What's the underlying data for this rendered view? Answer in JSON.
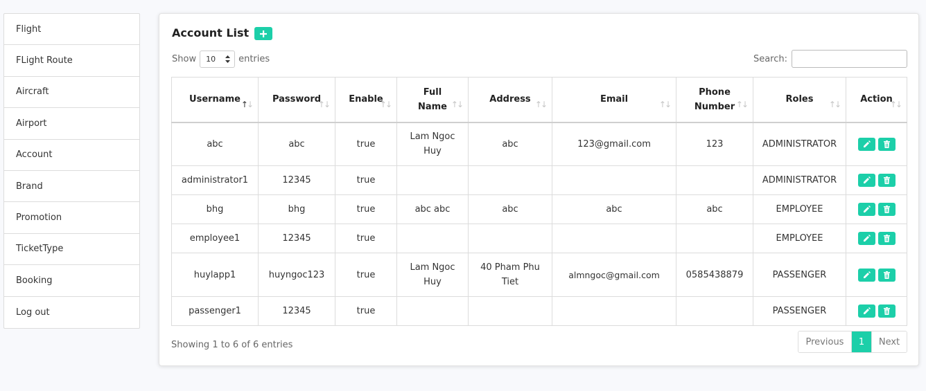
{
  "sidebar": {
    "items": [
      {
        "label": "Flight"
      },
      {
        "label": "FLight Route"
      },
      {
        "label": "Aircraft"
      },
      {
        "label": "Airport"
      },
      {
        "label": "Account"
      },
      {
        "label": "Brand"
      },
      {
        "label": "Promotion"
      },
      {
        "label": "TicketType"
      },
      {
        "label": "Booking"
      },
      {
        "label": "Log out"
      }
    ]
  },
  "main": {
    "title": "Account List",
    "add_icon": "plus-icon",
    "show_label": "Show",
    "entries_value": "10",
    "entries_label": "entries",
    "search_label": "Search:",
    "search_value": "",
    "accent_color": "#1ccfa9"
  },
  "table": {
    "columns": [
      {
        "label": "Username",
        "sorted": "asc"
      },
      {
        "label": "Password",
        "sorted": "none"
      },
      {
        "label": "Enable",
        "sorted": "none"
      },
      {
        "label": "Full Name",
        "sorted": "none"
      },
      {
        "label": "Address",
        "sorted": "none"
      },
      {
        "label": "Email",
        "sorted": "none"
      },
      {
        "label": "Phone Number",
        "sorted": "none"
      },
      {
        "label": "Roles",
        "sorted": "none"
      },
      {
        "label": "Action",
        "sorted": "none"
      }
    ],
    "rows": [
      {
        "username": "abc",
        "password": "abc",
        "enable": "true",
        "full_name": "Lam Ngoc Huy",
        "address": "abc",
        "email": "123@gmail.com",
        "phone": "123",
        "roles": "ADMINISTRATOR"
      },
      {
        "username": "administrator1",
        "password": "12345",
        "enable": "true",
        "full_name": "",
        "address": "",
        "email": "",
        "phone": "",
        "roles": "ADMINISTRATOR"
      },
      {
        "username": "bhg",
        "password": "bhg",
        "enable": "true",
        "full_name": "abc abc",
        "address": "abc",
        "email": "abc",
        "phone": "abc",
        "roles": "EMPLOYEE"
      },
      {
        "username": "employee1",
        "password": "12345",
        "enable": "true",
        "full_name": "",
        "address": "",
        "email": "",
        "phone": "",
        "roles": "EMPLOYEE"
      },
      {
        "username": "huylapp1",
        "password": "huyngoc123",
        "enable": "true",
        "full_name": "Lam Ngoc Huy",
        "address": "40 Pham Phu Tiet",
        "email": "almngoc@gmail.com",
        "phone": "0585438879",
        "roles": "PASSENGER"
      },
      {
        "username": "passenger1",
        "password": "12345",
        "enable": "true",
        "full_name": "",
        "address": "",
        "email": "",
        "phone": "",
        "roles": "PASSENGER"
      }
    ],
    "action_icons": [
      "pencil-icon",
      "trash-icon"
    ]
  },
  "footer": {
    "info": "Showing 1 to 6 of 6 entries",
    "prev_label": "Previous",
    "current_page": "1",
    "next_label": "Next"
  }
}
